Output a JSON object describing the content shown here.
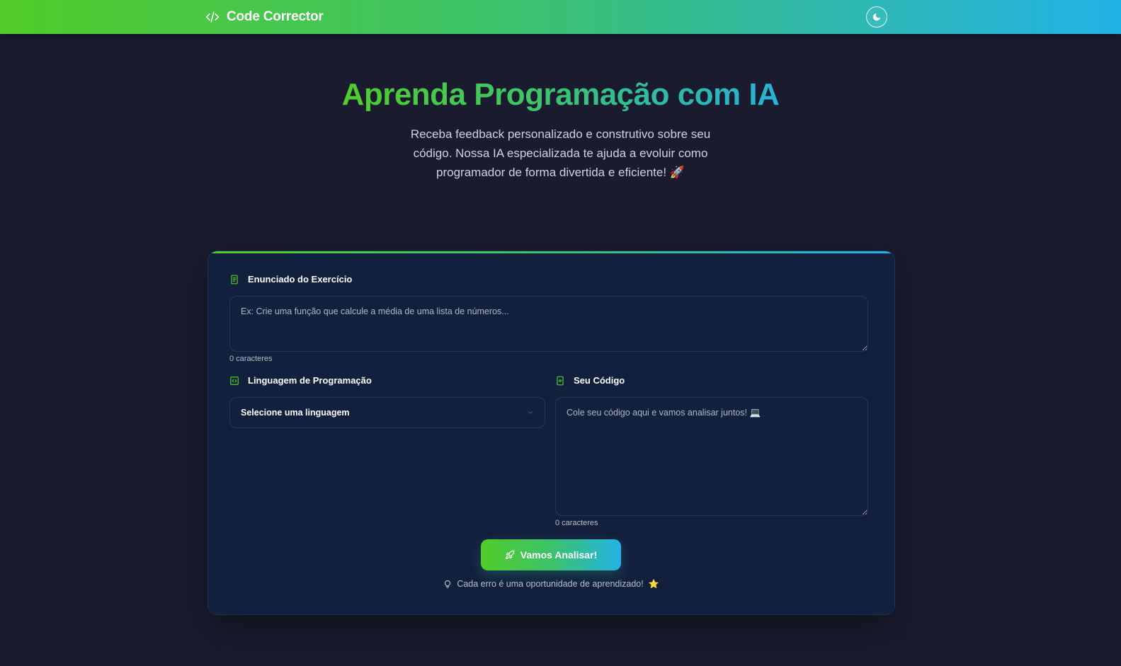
{
  "app": {
    "name": "Code Corrector"
  },
  "colors": {
    "accent_green": "#52cc2a",
    "accent_blue": "#22b3e6",
    "background": "#1a1b2e",
    "card": "#13203d"
  },
  "header": {
    "brand_icon": "code-icon",
    "theme_toggle_icon": "moon-icon"
  },
  "hero": {
    "title": "Aprenda Programação com IA",
    "subtitle": "Receba feedback personalizado e construtivo sobre seu código. Nossa IA especializada te ajuda a evoluir como programador de forma divertida e eficiente! 🚀"
  },
  "form": {
    "statement": {
      "label": "Enunciado do Exercício",
      "icon": "document-icon",
      "placeholder": "Ex: Crie uma função que calcule a média de uma lista de números...",
      "counter": "0 caracteres"
    },
    "language": {
      "label": "Linguagem de Programação",
      "icon": "code-square-icon",
      "selected": "Selecione uma linguagem"
    },
    "code": {
      "label": "Seu Código",
      "icon": "code-file-icon",
      "placeholder": "Cole seu código aqui e vamos analisar juntos! 💻",
      "counter": "0 caracteres"
    },
    "submit_label": "Vamos Analisar!",
    "tip": "Cada erro é uma oportunidade de aprendizado!",
    "tip_star": "⭐"
  }
}
